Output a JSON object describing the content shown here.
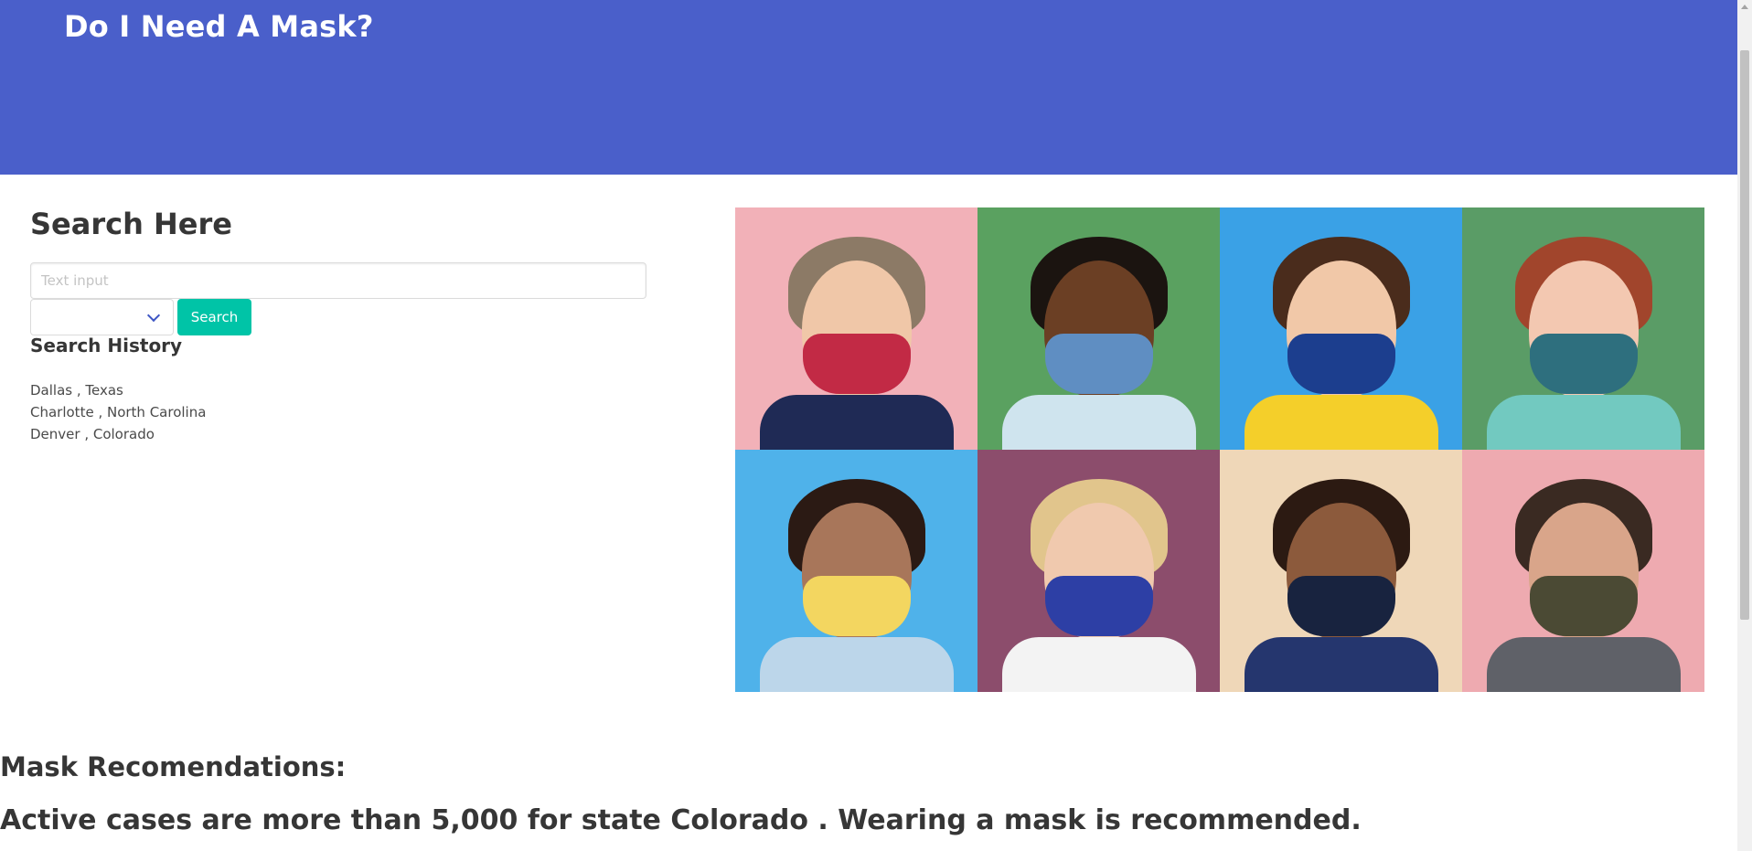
{
  "hero": {
    "title": "Do I Need A Mask?"
  },
  "search": {
    "heading": "Search Here",
    "placeholder": "Text input",
    "select_value": "",
    "button_label": "Search"
  },
  "history": {
    "heading": "Search History",
    "items": [
      "Dallas , Texas",
      "Charlotte , North Carolina",
      "Denver , Colorado"
    ]
  },
  "photos": [
    {
      "name": "photo-plaid-mask",
      "bg": "#f2b1b8",
      "hair": "#8c7a66",
      "skin": "#f0c7a8",
      "mask": "#c22a45",
      "shirt": "#1f2a55"
    },
    {
      "name": "photo-denim-mask",
      "bg": "#5aa160",
      "hair": "#1b1410",
      "skin": "#6b3f24",
      "mask": "#5f8ec2",
      "shirt": "#cfe4ee"
    },
    {
      "name": "photo-banana-mask",
      "bg": "#3aa1e6",
      "hair": "#4a2c1c",
      "skin": "#f1c8a8",
      "mask": "#1c3e8e",
      "shirt": "#f4cf2a"
    },
    {
      "name": "photo-gingham-mask",
      "bg": "#5a9c66",
      "hair": "#a1452c",
      "skin": "#f3c8b1",
      "mask": "#2e6f7e",
      "shirt": "#72c9c0"
    },
    {
      "name": "photo-yellow-floral-mask",
      "bg": "#4fb2ea",
      "hair": "#2b1a14",
      "skin": "#a8765a",
      "mask": "#f3d660",
      "shirt": "#bcd6ea"
    },
    {
      "name": "photo-blue-leaf-mask",
      "bg": "#8c4d6c",
      "hair": "#e1c58c",
      "skin": "#f0c9ae",
      "mask": "#2d3fa5",
      "shirt": "#f3f3f3"
    },
    {
      "name": "photo-polka-dot-mask",
      "bg": "#efd7b8",
      "hair": "#2c1a12",
      "skin": "#8c5a3c",
      "mask": "#18233f",
      "shirt": "#25366e"
    },
    {
      "name": "photo-camo-mask",
      "bg": "#eeaab0",
      "hair": "#3a2a22",
      "skin": "#d9a58a",
      "mask": "#4b4a34",
      "shirt": "#5f6168"
    }
  ],
  "recommendations": {
    "heading": "Mask Recomendations:",
    "text": "Active cases are more than 5,000 for state Colorado . Wearing a mask is recommended."
  },
  "colors": {
    "hero_bg": "#4a5fca",
    "button_bg": "#00c4a7",
    "select_chevron": "#3e56c4"
  }
}
